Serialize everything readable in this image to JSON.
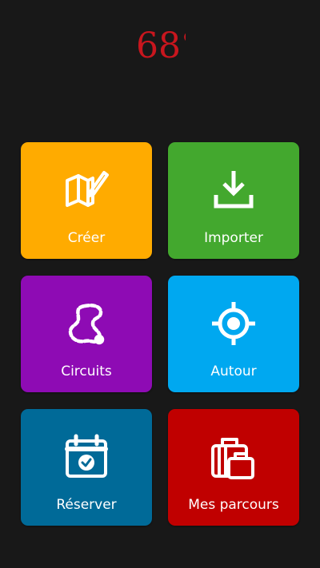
{
  "app": {
    "logo_text": "68°"
  },
  "colors": {
    "background": "#181818",
    "logo": "#c8161e",
    "creer": "#ffab00",
    "importer": "#43a82e",
    "circuits": "#8e0bb4",
    "autour": "#00a8f0",
    "reserver": "#006a98",
    "parcours": "#c00000"
  },
  "tiles": [
    {
      "label": "Créer",
      "icon": "map-edit-icon"
    },
    {
      "label": "Importer",
      "icon": "download-icon"
    },
    {
      "label": "Circuits",
      "icon": "route-icon"
    },
    {
      "label": "Autour",
      "icon": "gps-target-icon"
    },
    {
      "label": "Réserver",
      "icon": "calendar-check-icon"
    },
    {
      "label": "Mes parcours",
      "icon": "luggage-icon"
    }
  ]
}
